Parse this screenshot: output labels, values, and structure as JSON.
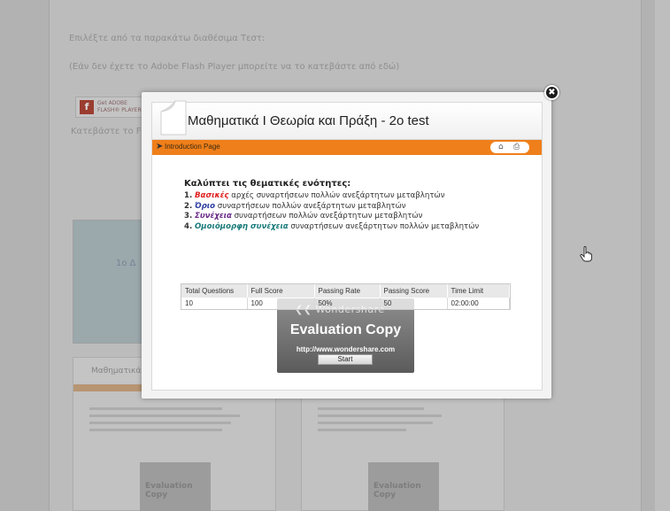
{
  "background": {
    "line1": "Επιλέξτε από τα παρακάτω διαθέσιμα Τεστ:",
    "line2": "(Εάν δεν έχετε το Adobe Flash Player μπορείτε να το κατεβάστε από εδώ)",
    "flash_line1": "Get ADOBE",
    "flash_line2": "FLASH® PLAYER",
    "download_text": "Κατεβάστε το Fla",
    "thumb_title": "1ο Δ",
    "card_title": "Μαθηματικά Ι Θ",
    "card_eval": "Evaluation Copy"
  },
  "modal": {
    "close_icon": "✖",
    "title": "Μαθηματικά Ι Θεωρία και Πράξη - 2ο test",
    "bar": {
      "arrow": "➤",
      "label": "Introduction Page",
      "icons": [
        "home-icon",
        "print-icon"
      ]
    },
    "content": {
      "heading": "Καλύπτει τις θεματικές ενότητες:",
      "items": [
        {
          "num": "1.",
          "keyword": "Βασικές",
          "keyword_color": "#e02020",
          "rest": " αρχές συναρτήσεων πολλών ανεξάρτητων μεταβλητών"
        },
        {
          "num": "2.",
          "keyword": "Όριο",
          "keyword_color": "#2a3aa0",
          "rest": " συναρτήσεων πολλών ανεξάρτητων μεταβλητών"
        },
        {
          "num": "3.",
          "keyword": "Συνέχεια",
          "keyword_color": "#6a2a8a",
          "rest": " συναρτήσεων πολλών ανεξάρτητων μεταβλητών"
        },
        {
          "num": "4.",
          "keyword": "Ομοιόμορφη συνέχεια",
          "keyword_color": "#1a7a7a",
          "rest": " συναρτήσεων ανεξάρτητων πολλών μεταβλητών"
        }
      ]
    },
    "stats": {
      "headers": [
        "Total Questions",
        "Full Score",
        "Passing Rate",
        "Passing Score",
        "Time Limit"
      ],
      "values": [
        "10",
        "100",
        "50%",
        "50",
        "02:00:00"
      ]
    },
    "watermark": {
      "brand": "Wondershare",
      "evaluation": "Evaluation Copy",
      "url": "http://www.wondershare.com"
    },
    "start_label": "Start"
  },
  "colors": {
    "accent": "#ef7f1a"
  }
}
